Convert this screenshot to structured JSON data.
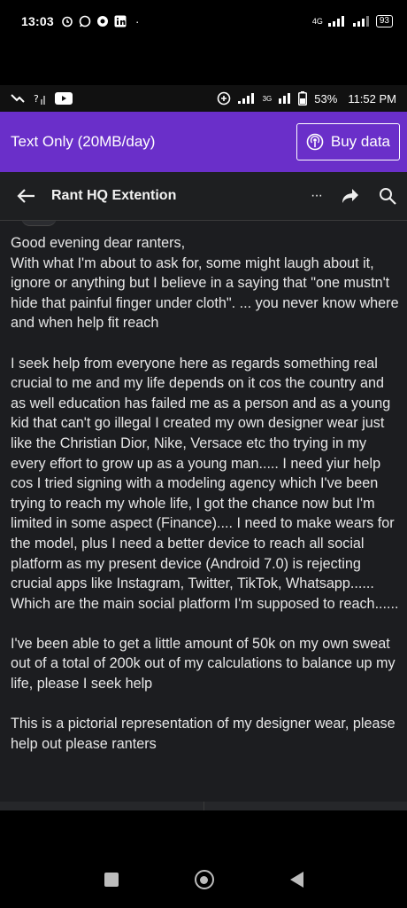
{
  "outer_status": {
    "time": "13:03",
    "icons": [
      "alarm-icon",
      "whatsapp-icon",
      "vpn-icon",
      "linkedin-icon"
    ],
    "dot": "·",
    "network": "4G",
    "battery": "93"
  },
  "inner_status": {
    "battery_percent": "53%",
    "time": "11:52 PM",
    "network": "3G"
  },
  "banner": {
    "mode_label": "Text Only (20MB/day)",
    "buy_label": "Buy data",
    "color": "#6a2fc9"
  },
  "toolbar": {
    "title": "Rant HQ Extention",
    "more": "···"
  },
  "post": {
    "paragraphs": [
      "Good evening dear ranters,\nWith what I'm about to ask for, some might laugh about it, ignore or anything but I believe in a saying that \"one mustn't hide that painful finger under cloth\". ... you never know where and when help fit reach",
      "I seek help from everyone here as regards something real crucial to me and my life depends on it cos the country and as well education has failed me as a person and as a young kid that can't go illegal I created my own designer wear just like the Christian Dior, Nike, Versace etc tho trying in my every effort to grow up as a young man..... I need yiur help  cos I tried signing with a modeling agency which I've been trying to reach my whole life, I got the chance now but I'm limited in some aspect (Finance).... I need to make wears for the model, plus I need a better device to reach all social platform as my present device (Android 7.0) is rejecting crucial apps like Instagram, Twitter, TikTok, Whatsapp...... Which are the main social platform I'm supposed to reach......",
      "I've been able to get a little amount of 50k on my own sweat out of a total of 200k out of my calculations to balance up my life, please I seek help",
      "This is a pictorial representation of my designer wear, please help out please ranters"
    ]
  }
}
